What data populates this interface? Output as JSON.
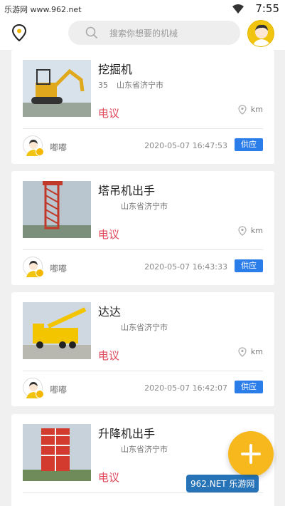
{
  "status": {
    "watermark": "乐游网 www.962.net",
    "time": "7:55"
  },
  "header": {
    "search_placeholder": "搜索你想要的机械"
  },
  "listings": [
    {
      "title": "挖掘机",
      "count": "35",
      "location": "山东省济宁市",
      "price": "电议",
      "distance": "km",
      "user": "嘟嘟",
      "time": "2020-05-07 16:47:53",
      "tag": "供应"
    },
    {
      "title": "塔吊机出手",
      "count": "",
      "location": "山东省济宁市",
      "price": "电议",
      "distance": "km",
      "user": "嘟嘟",
      "time": "2020-05-07 16:43:33",
      "tag": "供应"
    },
    {
      "title": "达达",
      "count": "",
      "location": "山东省济宁市",
      "price": "电议",
      "distance": "km",
      "user": "嘟嘟",
      "time": "2020-05-07 16:42:07",
      "tag": "供应"
    },
    {
      "title": "升降机出手",
      "count": "",
      "location": "山东省济宁市",
      "price": "电议",
      "distance": "",
      "user": "",
      "time": "",
      "tag": ""
    }
  ],
  "bottom_watermark": "962.NET 乐游网"
}
